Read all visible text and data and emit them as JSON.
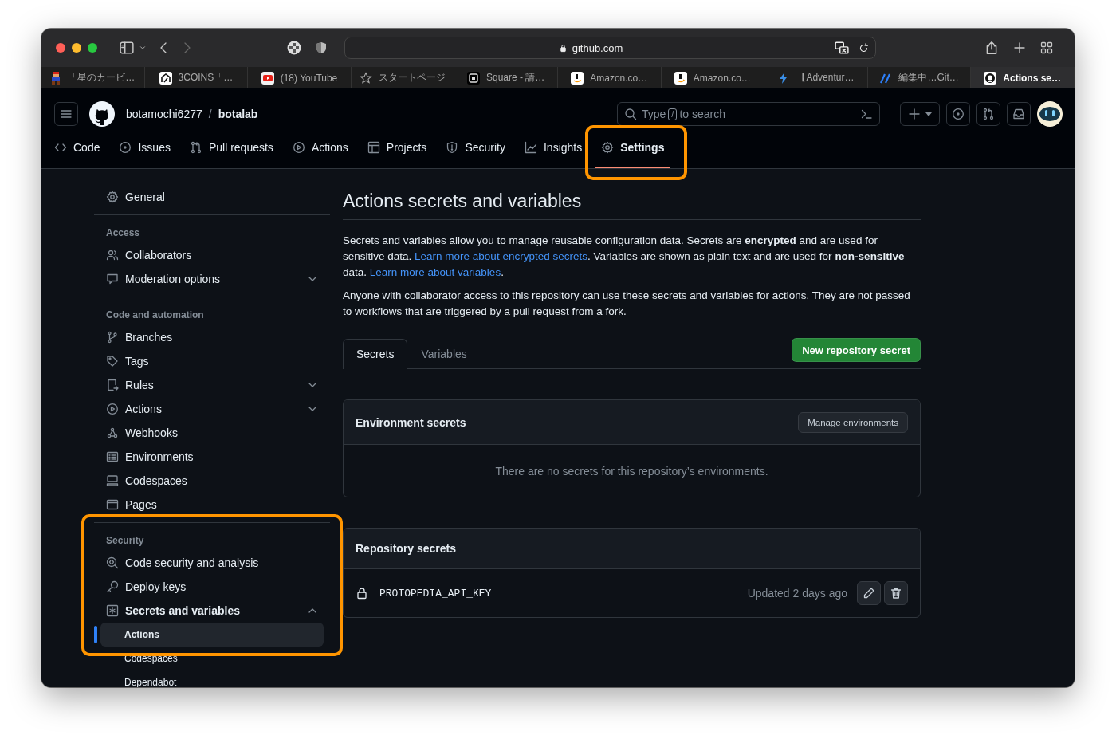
{
  "browser": {
    "address": "github.com",
    "tabs": [
      {
        "label": "「星のカービ…",
        "selected": false
      },
      {
        "label": "3COINS「…",
        "selected": false
      },
      {
        "label": "(18) YouTube",
        "selected": false
      },
      {
        "label": "スタートページ",
        "selected": false
      },
      {
        "label": "Square - 請…",
        "selected": false
      },
      {
        "label": "Amazon.co…",
        "selected": false
      },
      {
        "label": "Amazon.co…",
        "selected": false
      },
      {
        "label": "【Adventur…",
        "selected": false
      },
      {
        "label": "編集中…Git…",
        "selected": false
      },
      {
        "label": "Actions se…",
        "selected": true
      }
    ]
  },
  "header": {
    "owner": "botamochi6277",
    "separator": "/",
    "repo": "botalab",
    "search": {
      "before": "Type",
      "key": "/",
      "after": "to search"
    }
  },
  "repo_nav": [
    {
      "label": "Code",
      "selected": false,
      "highlighted": false
    },
    {
      "label": "Issues",
      "selected": false,
      "highlighted": false
    },
    {
      "label": "Pull requests",
      "selected": false,
      "highlighted": false
    },
    {
      "label": "Actions",
      "selected": false,
      "highlighted": false
    },
    {
      "label": "Projects",
      "selected": false,
      "highlighted": false
    },
    {
      "label": "Security",
      "selected": false,
      "highlighted": false
    },
    {
      "label": "Insights",
      "selected": false,
      "highlighted": false
    },
    {
      "label": "Settings",
      "selected": true,
      "highlighted": true
    }
  ],
  "sidebar": [
    {
      "highlighted": false,
      "items": [
        {
          "label": "General",
          "selected": false
        }
      ]
    },
    {
      "heading": "Access",
      "highlighted": false,
      "items": [
        {
          "label": "Collaborators",
          "selected": false
        },
        {
          "label": "Moderation options",
          "selected": false,
          "expanded": false
        }
      ]
    },
    {
      "heading": "Code and automation",
      "highlighted": false,
      "items": [
        {
          "label": "Branches",
          "selected": false
        },
        {
          "label": "Tags",
          "selected": false
        },
        {
          "label": "Rules",
          "selected": false,
          "expanded": false
        },
        {
          "label": "Actions",
          "selected": false,
          "expanded": false
        },
        {
          "label": "Webhooks",
          "selected": false
        },
        {
          "label": "Environments",
          "selected": false
        },
        {
          "label": "Codespaces",
          "selected": false
        },
        {
          "label": "Pages",
          "selected": false
        }
      ]
    },
    {
      "heading": "Security",
      "highlighted": true,
      "items": [
        {
          "label": "Code security and analysis",
          "selected": false
        },
        {
          "label": "Deploy keys",
          "selected": false
        },
        {
          "label": "Secrets and variables",
          "selected": false,
          "expanded": true,
          "children": [
            {
              "label": "Actions",
              "selected": true
            },
            {
              "label": "Codespaces",
              "selected": false
            },
            {
              "label": "Dependabot",
              "selected": false
            }
          ]
        }
      ]
    }
  ],
  "main": {
    "title": "Actions secrets and variables",
    "paragraphs": [
      [
        {
          "kind": "text",
          "text": "Secrets and variables allow you to manage reusable configuration data. Secrets are **encrypted** and are used for sensitive data. "
        },
        {
          "kind": "link",
          "text": "Learn more about encrypted secrets"
        },
        {
          "kind": "text",
          "text": ". Variables are shown as plain text and are used for **non-sensitive** data. "
        },
        {
          "kind": "link",
          "text": "Learn more about variables"
        },
        {
          "kind": "text",
          "text": "."
        }
      ],
      [
        {
          "kind": "text",
          "text": "Anyone with collaborator access to this repository can use these secrets and variables for actions. They are not passed to workflows that are triggered by a pull request from a fork."
        }
      ]
    ],
    "tabs": [
      {
        "label": "Secrets",
        "selected": true
      },
      {
        "label": "Variables",
        "selected": false
      }
    ],
    "new_button": "New repository secret",
    "environment_secrets": {
      "title": "Environment secrets",
      "button": "Manage environments",
      "empty": "There are no secrets for this repository’s environments."
    },
    "repository_secrets": {
      "title": "Repository secrets",
      "rows": [
        {
          "name": "PROTOPEDIA_API_KEY",
          "updated": "Updated 2 days ago"
        }
      ]
    }
  }
}
